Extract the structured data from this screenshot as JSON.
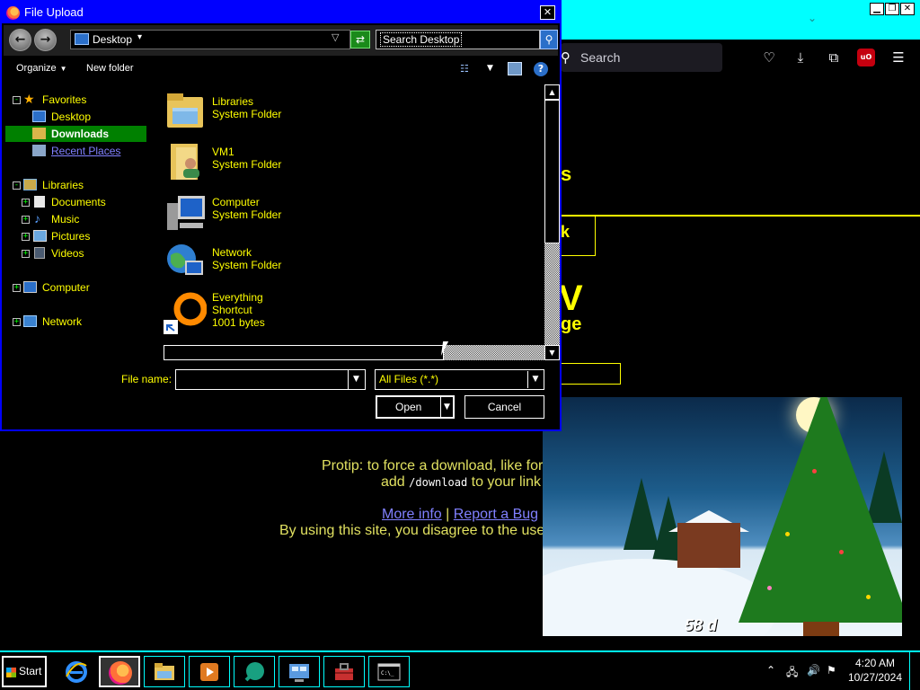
{
  "colors": {
    "dialog_title_bg": "#0000ff",
    "highlight_text": "#ffff00",
    "selection_bg": "#008000",
    "link": "#8080ff",
    "browser_accent": "#00ffff"
  },
  "browser": {
    "search_label": "Search",
    "toolbar_icons": [
      "pocket-icon",
      "download-icon",
      "extensions-icon",
      "ublock-icon",
      "menu-icon"
    ],
    "ublock_label": "uO",
    "page_fragments": {
      "s": "s",
      "k": "k",
      "v": "V",
      "ge": "ge"
    },
    "protip_line1": "Protip: to force a download, like for",
    "protip_add": "add",
    "protip_code": "/download",
    "protip_rest": "to your link",
    "more_info": "More info",
    "separator": "|",
    "report_bug": "Report a Bug",
    "disclaimer": "By using this site, you disagree to the use"
  },
  "xmas": {
    "days_text": "58 d"
  },
  "dialog": {
    "title": "File Upload",
    "close_glyph": "✕",
    "address": "Desktop",
    "search_placeholder": "Search Desktop",
    "organize": "Organize",
    "new_folder": "New folder",
    "help_glyph": "?",
    "tree": {
      "favorites": "Favorites",
      "desktop": "Desktop",
      "downloads": "Downloads",
      "recent_places": "Recent Places",
      "libraries": "Libraries",
      "documents": "Documents",
      "music": "Music",
      "pictures": "Pictures",
      "videos": "Videos",
      "computer": "Computer",
      "network": "Network"
    },
    "files": [
      {
        "name": "Libraries",
        "type": "System Folder",
        "icon": "libraries-folder-icon"
      },
      {
        "name": "VM1",
        "type": "System Folder",
        "icon": "user-folder-icon"
      },
      {
        "name": "Computer",
        "type": "System Folder",
        "icon": "computer-icon"
      },
      {
        "name": "Network",
        "type": "System Folder",
        "icon": "network-icon"
      },
      {
        "name": "Everything",
        "type": "Shortcut",
        "size": "1001 bytes",
        "icon": "everything-shortcut-icon"
      }
    ],
    "filename_label": "File name:",
    "filename_value": "",
    "filetype": "All Files (*.*)",
    "open": "Open",
    "cancel": "Cancel"
  },
  "taskbar": {
    "start": "Start",
    "apps": [
      "internet-explorer-icon",
      "firefox-icon",
      "file-explorer-icon",
      "media-player-icon",
      "app-icon",
      "control-panel-icon",
      "toolbox-icon",
      "command-prompt-icon"
    ],
    "time": "4:20 AM",
    "date": "10/27/2024"
  }
}
